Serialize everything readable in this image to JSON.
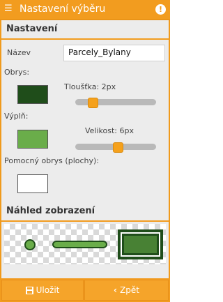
{
  "window": {
    "title": "Nastavení výběru",
    "info_glyph": "!"
  },
  "settings": {
    "heading": "Nastavení",
    "name_label": "Název",
    "name_value": "Parcely_Bylany",
    "outline_label": "Obrys:",
    "thickness_label": "Tloušťka: 2px",
    "thickness_fraction": 0.17,
    "fill_label": "Výplň:",
    "size_label": "Velikost: 6px",
    "size_fraction": 0.52,
    "aux_outline_label": "Pomocný obrys (plochy):",
    "colors": {
      "outline": "#1f4d1a",
      "fill": "#6aad4a",
      "aux_outline": "#ffffff",
      "accent": "#f29c1f"
    }
  },
  "preview": {
    "heading": "Náhled zobrazení"
  },
  "footer": {
    "save_label": "Uložit",
    "back_label": "Zpět"
  }
}
